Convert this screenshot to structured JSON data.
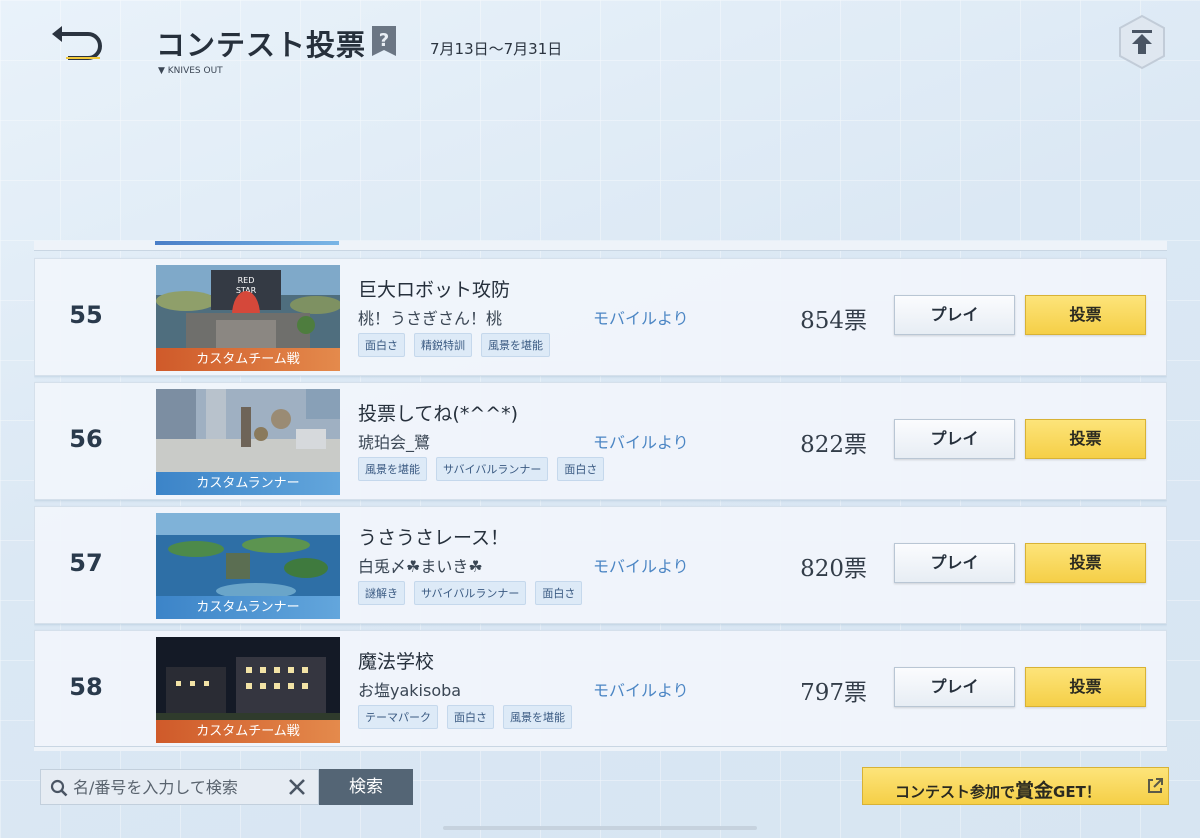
{
  "header": {
    "title": "コンテスト投票",
    "subtitle": "▼ KNIVES OUT",
    "date_range": "7月13日〜7月31日"
  },
  "rows": [
    {
      "rank": "55",
      "thumb_label": "カスタムチーム戦",
      "title": "巨大ロボット攻防",
      "author": "桃！うさぎさん！桃",
      "tags": [
        "面白さ",
        "精鋭特訓",
        "風景を堪能"
      ],
      "source": "モバイルより",
      "votes": "854票",
      "play_label": "プレイ",
      "vote_label": "投票"
    },
    {
      "rank": "56",
      "thumb_label": "カスタムランナー",
      "title": "投票してね(*^^*)",
      "author": "琥珀会_鷺",
      "tags": [
        "風景を堪能",
        "サバイバルランナー",
        "面白さ"
      ],
      "source": "モバイルより",
      "votes": "822票",
      "play_label": "プレイ",
      "vote_label": "投票"
    },
    {
      "rank": "57",
      "thumb_label": "カスタムランナー",
      "title": "うさうさレース！",
      "author": "白兎〆☘まいき☘",
      "tags": [
        "謎解き",
        "サバイバルランナー",
        "面白さ"
      ],
      "source": "モバイルより",
      "votes": "820票",
      "play_label": "プレイ",
      "vote_label": "投票"
    },
    {
      "rank": "58",
      "thumb_label": "カスタムチーム戦",
      "title": "魔法学校",
      "author": "お塩yakisoba",
      "tags": [
        "テーマパーク",
        "面白さ",
        "風景を堪能"
      ],
      "source": "モバイルより",
      "votes": "797票",
      "play_label": "プレイ",
      "vote_label": "投票"
    }
  ],
  "search": {
    "placeholder": "名/番号を入力して検索",
    "button_label": "検索"
  },
  "promo": {
    "prefix": "コンテスト参加で",
    "highlight": "賞金",
    "suffix": "GET！"
  },
  "colors": {
    "accent_yellow": "#f5cf47",
    "source_blue": "#4c86c4",
    "team_label": "#cf5a2a",
    "runner_label": "#3c84c8"
  },
  "icons": [
    "back-arrow-icon",
    "help-icon",
    "scroll-top-icon",
    "search-icon",
    "clear-icon",
    "external-link-icon"
  ]
}
